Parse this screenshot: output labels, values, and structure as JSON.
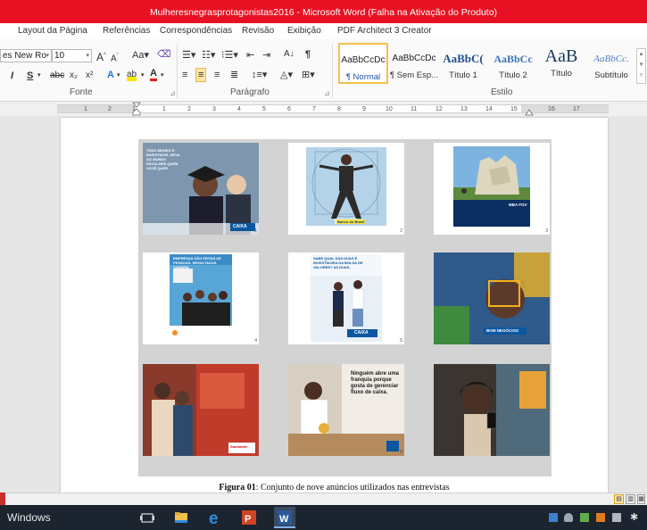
{
  "window": {
    "title": "Mulheresnegrasprotagonistas2016 - Microsoft Word (Falha na Ativação do Produto)"
  },
  "tabs": [
    "Layout da Página",
    "Referências",
    "Correspondências",
    "Revisão",
    "Exibição",
    "PDF Architect 3 Creator"
  ],
  "ribbon": {
    "font": {
      "name": "es New Ro",
      "size": "10",
      "group_label": "Fonte"
    },
    "paragraph": {
      "group_label": "Parágrafo"
    },
    "styles": {
      "group_label": "Estilo",
      "items": [
        {
          "preview": "AaBbCcDc",
          "name": "¶ Normal"
        },
        {
          "preview": "AaBbCcDc",
          "name": "¶ Sem Esp..."
        },
        {
          "preview": "AaBbC(",
          "name": "Título 1"
        },
        {
          "preview": "AaBbCc",
          "name": "Título 2"
        },
        {
          "preview": "AaB",
          "name": "Título"
        },
        {
          "preview": "AaBbCc.",
          "name": "Subtítulo"
        }
      ]
    }
  },
  "ruler": {
    "labels": [
      "1",
      "2",
      "1",
      "1",
      "2",
      "3",
      "4",
      "5",
      "6",
      "7",
      "8",
      "9",
      "10",
      "11",
      "12",
      "13",
      "14",
      "15",
      "16",
      "17"
    ]
  },
  "document": {
    "caption_label": "Figura 01",
    "caption_text": ": Conjunto de nove anúncios utilizados nas entrevistas",
    "ads": [
      {
        "number": "1",
        "text": "TODO MUNDO É INVESTIDOR. DEVA AO MUNDO ESCOLHER QUEM VOCÊ QUER.",
        "logo": "CAIXA"
      },
      {
        "number": "2",
        "text": "",
        "logo": "Banco do Brasil"
      },
      {
        "number": "3",
        "text": "",
        "logo": "MBA FGV"
      },
      {
        "number": "4",
        "text": "EMPRESAS SÃO FEITAS DE PESSOAS. RESULTADOS TAMBÉM.",
        "logo": ""
      },
      {
        "number": "5",
        "text": "SABE QUAL DAS DUAS É INVESTIDORA DA BOLSA DE VALORES? AS DUAS.",
        "logo": "CAIXA"
      },
      {
        "number": "6",
        "text": "BOM NEGÓCIOS",
        "logo": ""
      },
      {
        "number": "7",
        "text": "",
        "logo": "Santander"
      },
      {
        "number": "8",
        "text": "Ninguém abre uma franquia porque gosta de gerenciar fluxo de caixa.",
        "logo": ""
      },
      {
        "number": "9",
        "text": "",
        "logo": ""
      }
    ]
  },
  "taskbar": {
    "label": "Windows"
  }
}
